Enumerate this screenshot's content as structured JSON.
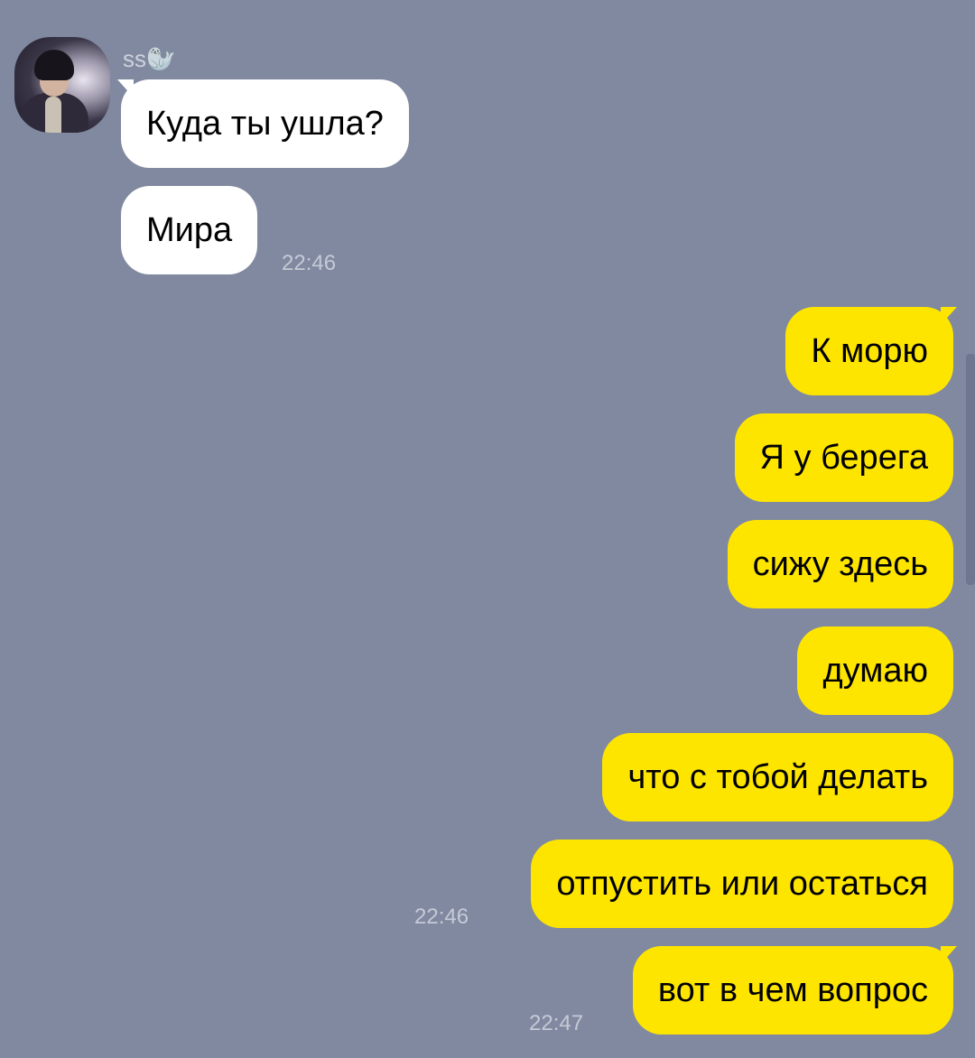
{
  "contact": {
    "name": "ss🦭"
  },
  "messages_in": [
    {
      "text": "Куда ты ушла?"
    },
    {
      "text": "Мира",
      "time": "22:46"
    }
  ],
  "messages_out": [
    {
      "text": "К морю"
    },
    {
      "text": "Я у берега"
    },
    {
      "text": "сижу здесь "
    },
    {
      "text": "думаю"
    },
    {
      "text": "что с тобой делать"
    },
    {
      "text": "отпустить или остаться",
      "time": "22:46"
    },
    {
      "text": "вот в чем вопрос",
      "time": "22:47"
    }
  ],
  "colors": {
    "background": "#8089a0",
    "incoming_bubble": "#ffffff",
    "outgoing_bubble": "#fee500"
  }
}
